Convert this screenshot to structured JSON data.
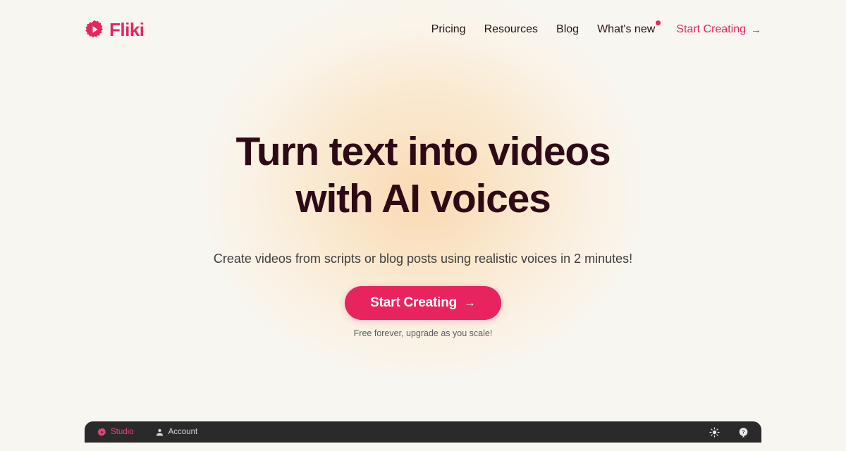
{
  "brand": {
    "name": "Fliki",
    "logo_icon": "fliki-gear-play-logo",
    "accent_color": "#e8245f"
  },
  "header": {
    "nav": [
      {
        "label": "Pricing",
        "name": "nav-link-pricing",
        "badge": false
      },
      {
        "label": "Resources",
        "name": "nav-link-resources",
        "badge": false
      },
      {
        "label": "Blog",
        "name": "nav-link-blog",
        "badge": false
      },
      {
        "label": "What's new",
        "name": "nav-link-whats-new",
        "badge": true
      }
    ],
    "cta": {
      "label": "Start Creating",
      "arrow": "→"
    }
  },
  "hero": {
    "title_line1": "Turn text into videos",
    "title_line2": "with AI voices",
    "subtitle": "Create videos from scripts or blog posts using realistic voices in 2 minutes!",
    "cta_label": "Start Creating",
    "cta_arrow": "→",
    "cta_note": "Free forever, upgrade as you scale!",
    "title_color": "#2d0a16",
    "background_color": "#f8f6f1",
    "glow_color": "#fadcb8"
  },
  "appbar": {
    "background_color": "#2a2a2b",
    "items": [
      {
        "label": "Studio",
        "icon": "studio-gear-play-icon",
        "active": true
      },
      {
        "label": "Account",
        "icon": "person-icon",
        "active": false
      }
    ],
    "actions": [
      {
        "icon": "brightness-sun-icon",
        "name": "brightness-toggle"
      },
      {
        "icon": "help-question-icon",
        "name": "help-button"
      }
    ]
  }
}
